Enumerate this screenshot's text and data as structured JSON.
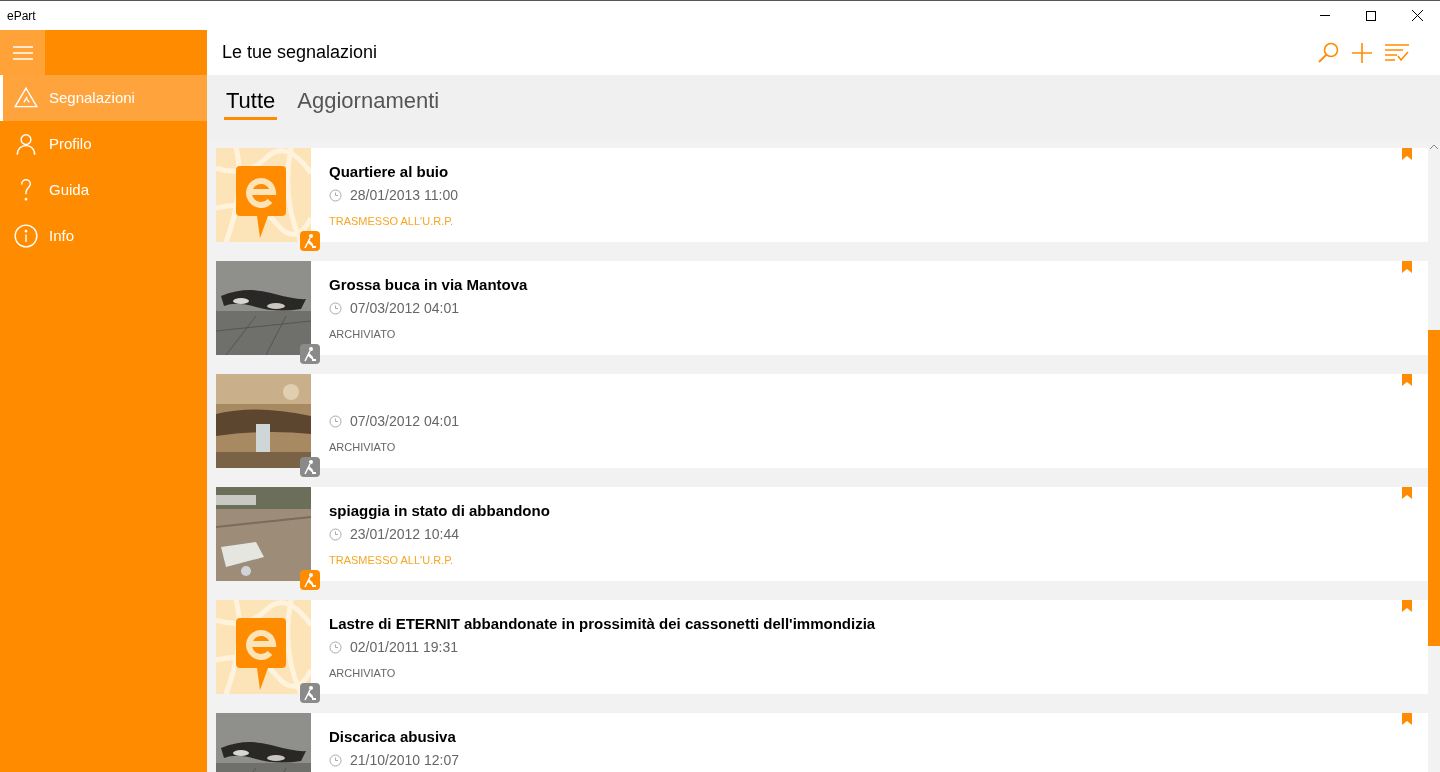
{
  "window": {
    "title": "ePart"
  },
  "sidebar": {
    "items": [
      {
        "label": "Segnalazioni",
        "selected": true
      },
      {
        "label": "Profilo",
        "selected": false
      },
      {
        "label": "Guida",
        "selected": false
      },
      {
        "label": "Info",
        "selected": false
      }
    ]
  },
  "header": {
    "title": "Le tue segnalazioni"
  },
  "tabs": [
    {
      "label": "Tutte",
      "selected": true
    },
    {
      "label": "Aggiornamenti",
      "selected": false
    }
  ],
  "reports": [
    {
      "thumbnail": {
        "kind": "logo"
      },
      "title": "Quartiere al buio",
      "date": "28/01/2013 11:00",
      "status": "TRASMESSO ALL'U.R.P.",
      "kind": "transmitted"
    },
    {
      "title": "Grossa buca in via Mantova",
      "date": "07/03/2012 04:01",
      "status": "ARCHIVIATO",
      "kind": "archived"
    },
    {
      "date": "07/03/2012 04:01",
      "status": "ARCHIVIATO",
      "kind": "archived"
    },
    {
      "title": "spiaggia in stato di abbandono",
      "date": "23/01/2012 10:44",
      "status": "TRASMESSO ALL'U.R.P.",
      "kind": "transmitted"
    },
    {
      "thumbnail": {
        "kind": "logo"
      },
      "title": "Lastre di ETERNIT abbandonate in prossimità dei cassonetti dell'immondizia",
      "date": "02/01/2011 19:31",
      "status": "ARCHIVIATO",
      "kind": "archived"
    },
    {
      "title": "Discarica abusiva",
      "date": "21/10/2010 12:07"
    }
  ]
}
